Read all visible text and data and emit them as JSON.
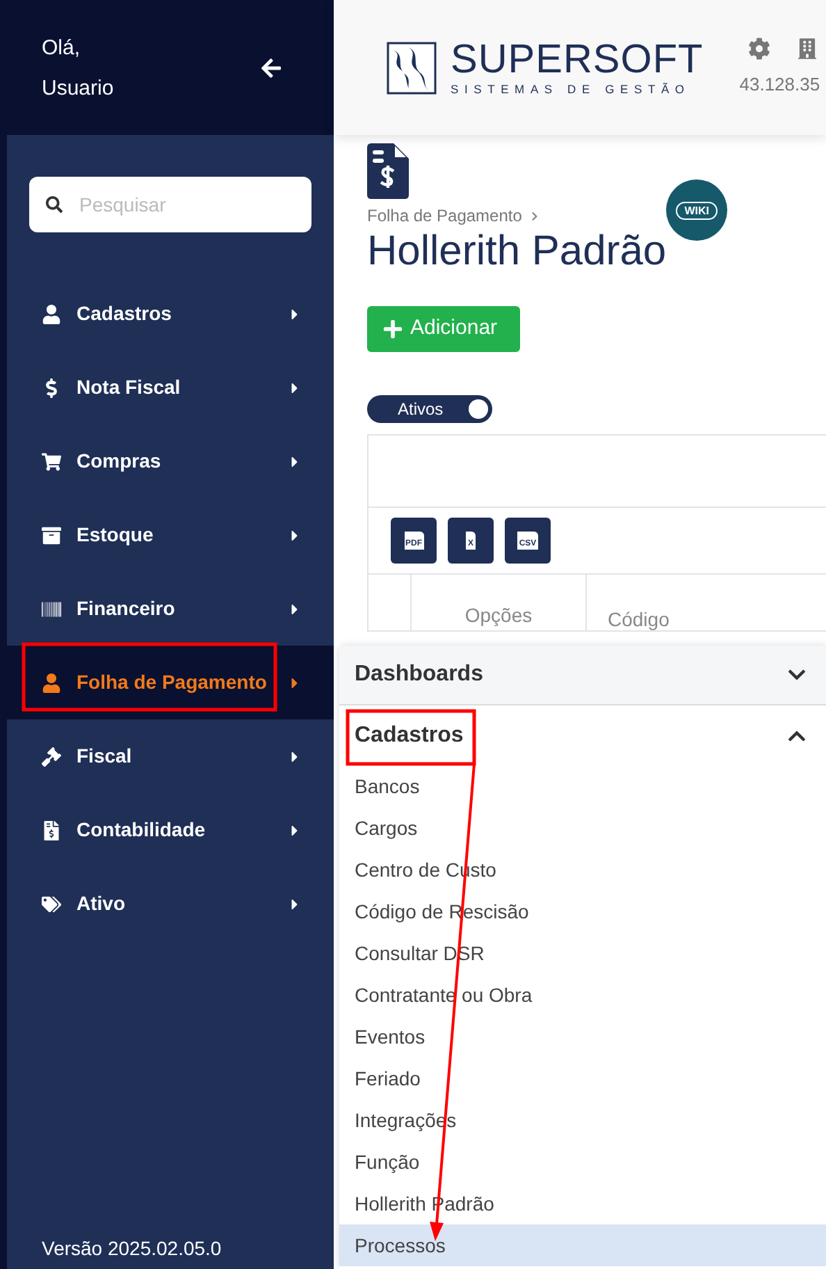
{
  "sidebar": {
    "greeting": "Olá,",
    "user": "Usuario",
    "search": {
      "placeholder": "Pesquisar"
    },
    "items": [
      {
        "label": "Cadastros",
        "selected": false
      },
      {
        "label": "Nota Fiscal",
        "selected": false
      },
      {
        "label": "Compras",
        "selected": false
      },
      {
        "label": "Estoque",
        "selected": false
      },
      {
        "label": "Financeiro",
        "selected": false
      },
      {
        "label": "Folha de Pagamento",
        "selected": true
      },
      {
        "label": "Fiscal",
        "selected": false
      },
      {
        "label": "Contabilidade",
        "selected": false
      },
      {
        "label": "Ativo",
        "selected": false
      }
    ],
    "version": "Versão 2025.02.05.0"
  },
  "header": {
    "logo_title": "SUPERSOFT",
    "logo_subtitle": "SISTEMAS DE GESTÃO",
    "company_id": "43.128.35"
  },
  "page": {
    "breadcrumb": "Folha de Pagamento",
    "title": "Hollerith Padrão",
    "wiki": "WIKI",
    "add_button": "Adicionar",
    "toggle": {
      "label": "Ativos",
      "on": true
    },
    "export_buttons": [
      "PDF",
      "X",
      "CSV"
    ],
    "table": {
      "columns": [
        "Opções",
        "Código"
      ]
    }
  },
  "menu": {
    "sections": [
      {
        "title": "Dashboards",
        "expanded": false
      },
      {
        "title": "Cadastros",
        "expanded": true,
        "items": [
          {
            "label": "Bancos",
            "selected": false
          },
          {
            "label": "Cargos",
            "selected": false
          },
          {
            "label": "Centro de Custo",
            "selected": false
          },
          {
            "label": "Código de Rescisão",
            "selected": false
          },
          {
            "label": "Consultar DSR",
            "selected": false
          },
          {
            "label": "Contratante ou Obra",
            "selected": false
          },
          {
            "label": "Eventos",
            "selected": false
          },
          {
            "label": "Feriado",
            "selected": false
          },
          {
            "label": "Integrações",
            "selected": false
          },
          {
            "label": "Função",
            "selected": false
          },
          {
            "label": "Hollerith Padrão",
            "selected": false
          },
          {
            "label": "Processos",
            "selected": true
          }
        ]
      }
    ]
  }
}
